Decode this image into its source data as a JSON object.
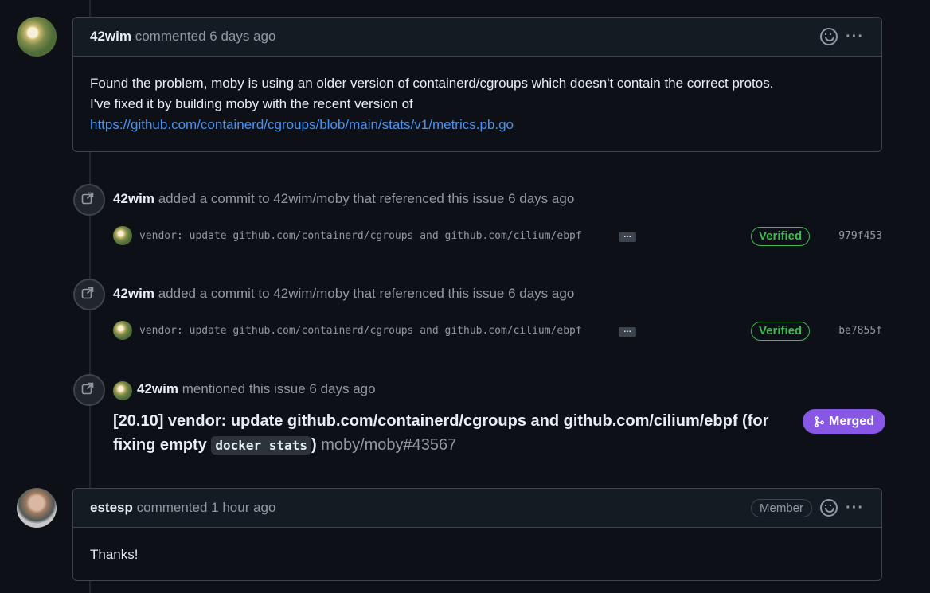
{
  "comment1": {
    "author": "42wim",
    "action": "commented",
    "time": "6 days ago",
    "line1": "Found the problem, moby is using an older version of containerd/cgroups which doesn't contain the correct protos.",
    "line2": "I've fixed it by building moby with the recent version of",
    "link": "https://github.com/containerd/cgroups/blob/main/stats/v1/metrics.pb.go"
  },
  "events": [
    {
      "author": "42wim",
      "text": "added a commit to 42wim/moby that referenced this issue 6 days ago",
      "commit_message": "vendor: update github.com/containerd/cgroups and github.com/cilium/ebpf",
      "expander": "…",
      "verified": "Verified",
      "sha": "979f453"
    },
    {
      "author": "42wim",
      "text": "added a commit to 42wim/moby that referenced this issue 6 days ago",
      "commit_message": "vendor: update github.com/containerd/cgroups and github.com/cilium/ebpf",
      "expander": "…",
      "verified": "Verified",
      "sha": "be7855f"
    }
  ],
  "mention": {
    "author": "42wim",
    "text": "mentioned this issue 6 days ago",
    "pr_title_part1": "[20.10] vendor: update github.com/containerd/cgroups and github.com/cilium/ebpf (for fixing empty",
    "pr_code": "docker stats",
    "pr_title_part2": ")",
    "pr_ref": "moby/moby#43567",
    "status": "Merged"
  },
  "comment2": {
    "author": "estesp",
    "action": "commented",
    "time": "1 hour ago",
    "role": "Member",
    "body": "Thanks!"
  },
  "icons": {
    "emoji": "smiley-icon",
    "more": "kebab-horizontal-icon",
    "cross_ref": "cross-reference-icon",
    "merged": "git-merge-icon"
  },
  "colors": {
    "background": "#0d1117",
    "link": "#4493f8",
    "verified": "#3fb950",
    "merged": "#8957e5"
  }
}
